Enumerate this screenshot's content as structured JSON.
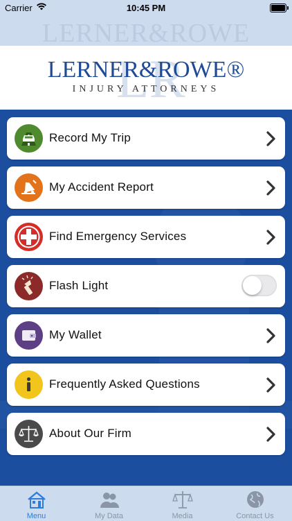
{
  "status_bar": {
    "carrier": "Carrier",
    "time": "10:45 PM"
  },
  "header": {
    "ghost_text": "LERNER&ROWE",
    "logo_name": "LERNER&ROWE®",
    "logo_subtitle": "INJURY ATTORNEYS",
    "logo_monogram": "LR"
  },
  "menu": {
    "items": [
      {
        "label": "Record My Trip",
        "icon": "car-road-icon",
        "icon_color": "#4f8b2e",
        "control": "chevron"
      },
      {
        "label": "My Accident Report",
        "icon": "accident-report-icon",
        "icon_color": "#e2731b",
        "control": "chevron"
      },
      {
        "label": "Find Emergency Services",
        "icon": "red-cross-icon",
        "icon_color": "#d62d27",
        "control": "chevron"
      },
      {
        "label": "Flash Light",
        "icon": "flashlight-icon",
        "icon_color": "#8c2a2a",
        "control": "toggle",
        "toggle_on": false
      },
      {
        "label": "My Wallet",
        "icon": "wallet-icon",
        "icon_color": "#5c3f84",
        "control": "chevron"
      },
      {
        "label": "Frequently Asked Questions",
        "icon": "info-icon",
        "icon_color": "#f1c51b",
        "control": "chevron"
      },
      {
        "label": "About Our Firm",
        "icon": "scales-icon",
        "icon_color": "#4a4a4a",
        "control": "chevron"
      }
    ]
  },
  "tabbar": {
    "tabs": [
      {
        "label": "Menu",
        "icon": "house-icon",
        "active": true
      },
      {
        "label": "My Data",
        "icon": "people-icon",
        "active": false
      },
      {
        "label": "Media",
        "icon": "scales-icon",
        "active": false
      },
      {
        "label": "Contact Us",
        "icon": "globe-icon",
        "active": false
      }
    ]
  },
  "colors": {
    "brand_blue": "#1c4ea0",
    "header_bg": "#cddbee",
    "tab_active": "#2f7ddb",
    "tab_inactive": "#8a96a8"
  }
}
